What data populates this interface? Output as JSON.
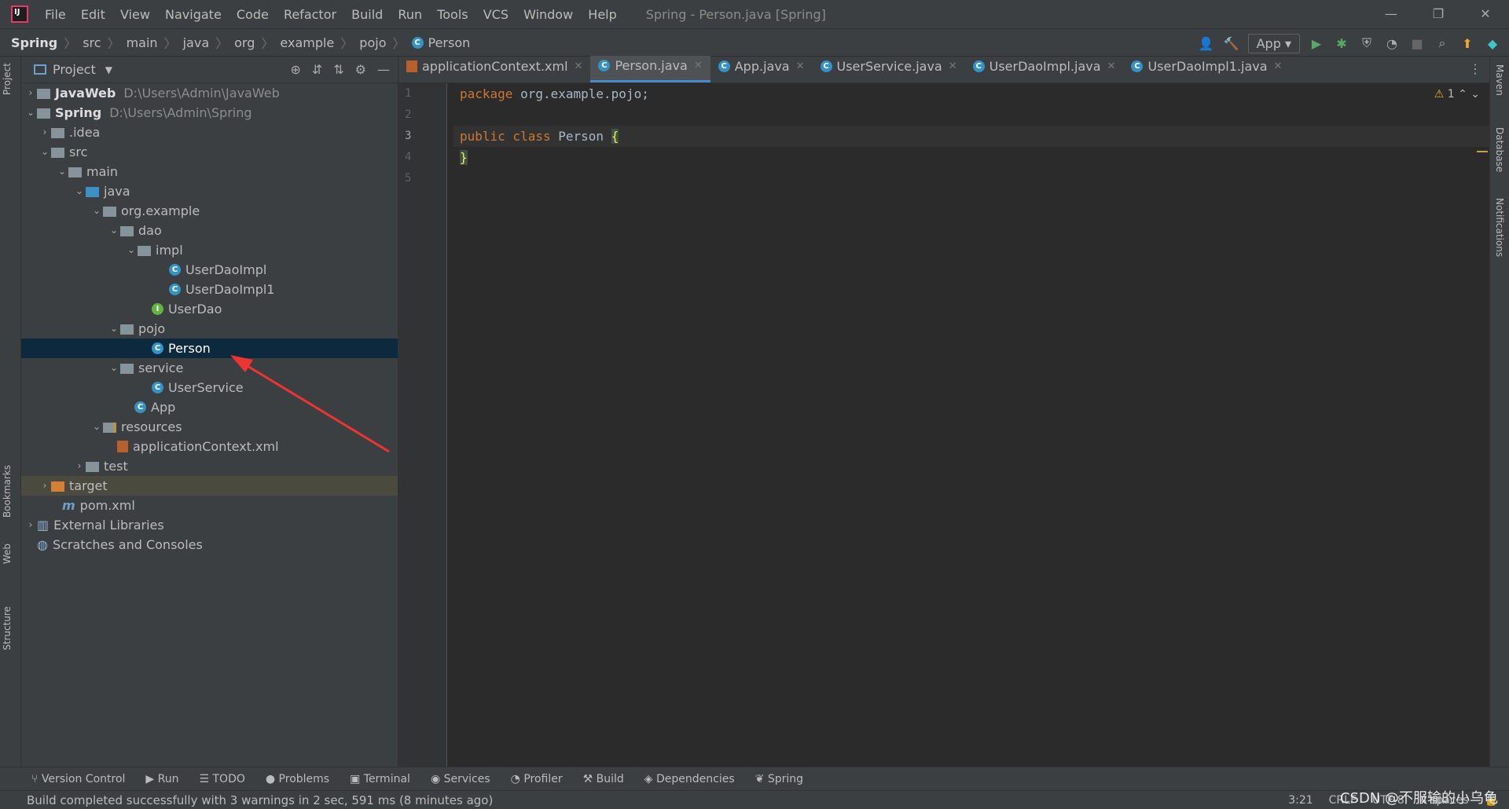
{
  "title_bar": {
    "menu": [
      "File",
      "Edit",
      "View",
      "Navigate",
      "Code",
      "Refactor",
      "Build",
      "Run",
      "Tools",
      "VCS",
      "Window",
      "Help"
    ],
    "window_title": "Spring - Person.java [Spring]"
  },
  "breadcrumb": [
    "Spring",
    "src",
    "main",
    "java",
    "org",
    "example",
    "pojo",
    "Person"
  ],
  "toolbar": {
    "run_config": "App"
  },
  "project_panel": {
    "title": "Project",
    "tree": [
      {
        "label": "JavaWeb",
        "path": "D:\\Users\\Admin\\JavaWeb"
      },
      {
        "label": "Spring",
        "path": "D:\\Users\\Admin\\Spring"
      },
      {
        "label": ".idea"
      },
      {
        "label": "src"
      },
      {
        "label": "main"
      },
      {
        "label": "java"
      },
      {
        "label": "org.example"
      },
      {
        "label": "dao"
      },
      {
        "label": "impl"
      },
      {
        "label": "UserDaoImpl"
      },
      {
        "label": "UserDaoImpl1"
      },
      {
        "label": "UserDao"
      },
      {
        "label": "pojo"
      },
      {
        "label": "Person"
      },
      {
        "label": "service"
      },
      {
        "label": "UserService"
      },
      {
        "label": "App"
      },
      {
        "label": "resources"
      },
      {
        "label": "applicationContext.xml"
      },
      {
        "label": "test"
      },
      {
        "label": "target"
      },
      {
        "label": "pom.xml"
      },
      {
        "label": "External Libraries"
      },
      {
        "label": "Scratches and Consoles"
      }
    ]
  },
  "editor": {
    "tabs": [
      "applicationContext.xml",
      "Person.java",
      "App.java",
      "UserService.java",
      "UserDaoImpl.java",
      "UserDaoImpl1.java"
    ],
    "active_tab": "Person.java",
    "line_numbers": [
      "1",
      "2",
      "3",
      "4",
      "5"
    ],
    "lines": {
      "l1_kw": "package",
      "l1_rest": " org.example.pojo;",
      "l3_kw": "public class",
      "l3_name": " Person ",
      "l3_brace": "{",
      "l4_brace": "}"
    },
    "warnings": "1"
  },
  "side_tools": {
    "left": [
      "Project",
      "Bookmarks",
      "Web",
      "Structure"
    ],
    "right": [
      "Maven",
      "Database",
      "Notifications"
    ]
  },
  "bottom_tools": [
    "Version Control",
    "Run",
    "TODO",
    "Problems",
    "Terminal",
    "Services",
    "Profiler",
    "Build",
    "Dependencies",
    "Spring"
  ],
  "status": {
    "message": "Build completed successfully with 3 warnings in 2 sec, 591 ms (8 minutes ago)",
    "position": "3:21",
    "line_sep": "CRLF",
    "encoding": "UTF-8",
    "indent": "4 spaces"
  },
  "watermark": "CSDN @不服输的小乌龟",
  "colors": {
    "accent": "#4a88c7",
    "selection": "#0d293e",
    "keyword": "#cc7832",
    "arrow": "#ee3333"
  }
}
